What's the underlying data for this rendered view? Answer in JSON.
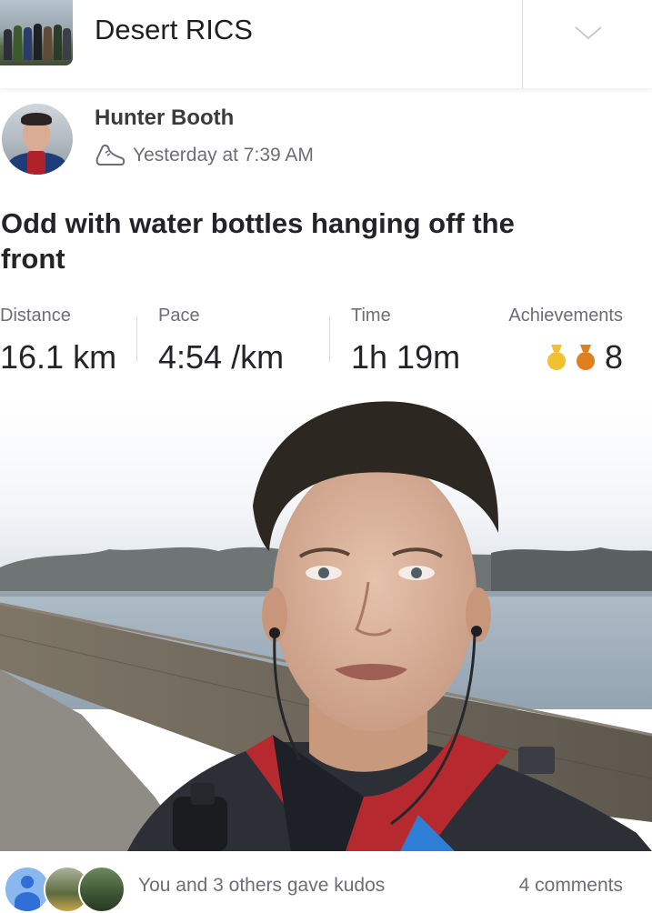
{
  "club": {
    "name": "Desert RICS",
    "photo_icon": "club-group-photo",
    "menu_icon": "chevron-down-icon"
  },
  "activity": {
    "athlete_name": "Hunter Booth",
    "type_icon": "shoe-icon",
    "timestamp": "Yesterday at 7:39 AM",
    "title": "Odd with water bottles hanging off the front",
    "stats": {
      "distance": {
        "label": "Distance",
        "value": "16.1 km"
      },
      "pace": {
        "label": "Pace",
        "value": "4:54 /km"
      },
      "time": {
        "label": "Time",
        "value": "1h 19m"
      },
      "achievements": {
        "label": "Achievements",
        "value": "8",
        "medal_colors": [
          "#f0c230",
          "#e07f1f"
        ]
      }
    }
  },
  "footer": {
    "kudos_text": "You and 3 others gave kudos",
    "comments_text": "4 comments"
  },
  "colors": {
    "brand_orange": "#fc4c02",
    "text_primary": "#242428",
    "text_secondary": "#6d6d78"
  }
}
